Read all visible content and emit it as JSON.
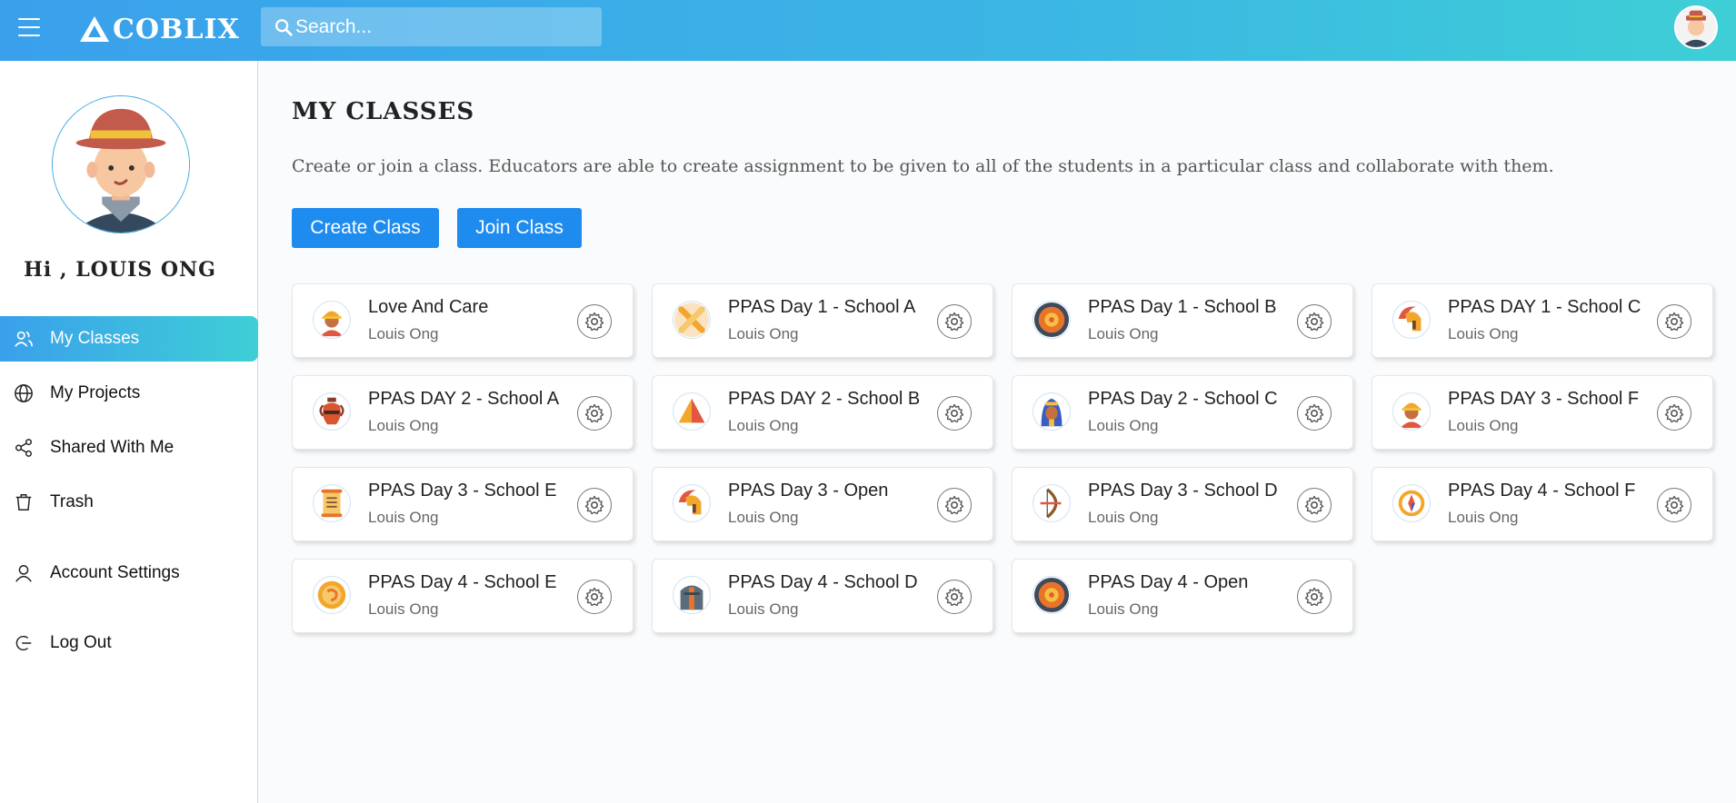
{
  "header": {
    "logo_text": "COBLIX",
    "search_placeholder": "Search..."
  },
  "sidebar": {
    "greeting": "Hi , LOUIS ONG",
    "items": [
      {
        "label": "My Classes",
        "icon": "users-icon",
        "active": true
      },
      {
        "label": "My Projects",
        "icon": "globe-icon"
      },
      {
        "label": "Shared With Me",
        "icon": "share-icon"
      },
      {
        "label": "Trash",
        "icon": "trash-icon"
      },
      {
        "label": "Account Settings",
        "icon": "user-icon"
      },
      {
        "label": "Log Out",
        "icon": "logout-icon"
      }
    ]
  },
  "main": {
    "title": "MY CLASSES",
    "description": "Create or join a class. Educators are able to create assignment to be given to all of the students in a particular class and collaborate with them.",
    "create_label": "Create Class",
    "join_label": "Join Class",
    "classes": [
      {
        "title": "Love And Care",
        "owner": "Louis Ong",
        "icon": "worker-avatar-icon"
      },
      {
        "title": "PPAS Day 1 - School A",
        "owner": "Louis Ong",
        "icon": "crossed-bones-icon"
      },
      {
        "title": "PPAS Day 1 - School B",
        "owner": "Louis Ong",
        "icon": "sun-shield-icon"
      },
      {
        "title": "PPAS DAY 1 - School C",
        "owner": "Louis Ong",
        "icon": "spartan-helmet-icon"
      },
      {
        "title": "PPAS DAY 2 - School A",
        "owner": "Louis Ong",
        "icon": "amphora-icon"
      },
      {
        "title": "PPAS DAY 2 - School B",
        "owner": "Louis Ong",
        "icon": "pyramid-icon"
      },
      {
        "title": "PPAS Day 2 - School C",
        "owner": "Louis Ong",
        "icon": "pharaoh-icon"
      },
      {
        "title": "PPAS DAY 3 - School F",
        "owner": "Louis Ong",
        "icon": "worker-avatar-icon"
      },
      {
        "title": "PPAS Day 3 - School E",
        "owner": "Louis Ong",
        "icon": "scroll-icon"
      },
      {
        "title": "PPAS Day 3 - Open",
        "owner": "Louis Ong",
        "icon": "spartan-helmet-icon"
      },
      {
        "title": "PPAS Day 3 - School D",
        "owner": "Louis Ong",
        "icon": "bow-arrow-icon"
      },
      {
        "title": "PPAS Day 4 - School F",
        "owner": "Louis Ong",
        "icon": "compass-icon"
      },
      {
        "title": "PPAS Day 4 - School E",
        "owner": "Louis Ong",
        "icon": "orange-coin-icon"
      },
      {
        "title": "PPAS Day 4 - School D",
        "owner": "Louis Ong",
        "icon": "knight-icon"
      },
      {
        "title": "PPAS Day 4 - Open",
        "owner": "Louis Ong",
        "icon": "sun-shield-icon"
      }
    ]
  }
}
